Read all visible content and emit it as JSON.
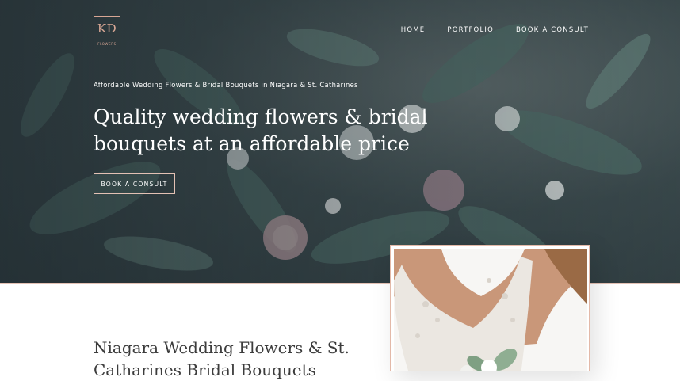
{
  "brand": {
    "logo_initials": "KD",
    "logo_subtext": "FLOWERS",
    "accent_color": "#d7a694"
  },
  "nav": {
    "items": [
      "HOME",
      "PORTFOLIO",
      "BOOK A CONSULT"
    ]
  },
  "hero": {
    "kicker": "Affordable Wedding Flowers & Bridal Bouquets in Niagara & St. Catharines",
    "headline": "Quality wedding flowers & bridal bouquets at an affordable price",
    "cta_label": "BOOK A CONSULT",
    "background": "bridal-bouquet-photo"
  },
  "section": {
    "title": "Niagara Wedding Flowers & St. Catharines Bridal Bouquets",
    "image": "bride-holding-bouquet-photo"
  }
}
